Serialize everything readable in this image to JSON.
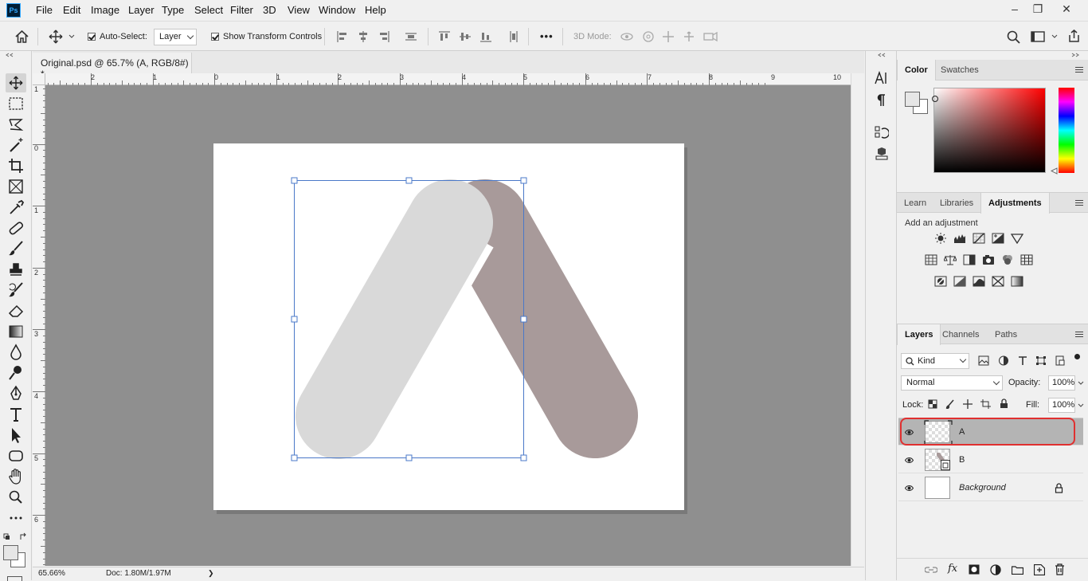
{
  "app": {
    "logo_text": "Ps",
    "menu": [
      "File",
      "Edit",
      "Image",
      "Layer",
      "Type",
      "Select",
      "Filter",
      "3D",
      "View",
      "Window",
      "Help"
    ],
    "window_controls": {
      "minimize": "‒",
      "restore": "❐",
      "close": "✕"
    }
  },
  "options_bar": {
    "auto_select_label": "Auto-Select:",
    "auto_select_checked": true,
    "auto_select_target": "Layer",
    "show_transform_label": "Show Transform Controls",
    "show_transform_checked": true,
    "more_label": "•••",
    "mode_3d_label": "3D Mode:"
  },
  "document": {
    "tab_title": "Original.psd @ 65.7% (A, RGB/8#) *",
    "ruler_h_labels": [
      "2",
      "1",
      "0",
      "1",
      "2",
      "3",
      "4",
      "5",
      "6",
      "7",
      "8",
      "9",
      "10"
    ],
    "ruler_v_labels": [
      "1",
      "0",
      "1",
      "2",
      "3",
      "4",
      "5",
      "6"
    ],
    "zoom": "65.66%",
    "doc_size": "Doc: 1.80M/1.97M",
    "status_arrow": "❯"
  },
  "panels": {
    "color_tabs": [
      "Color",
      "Swatches"
    ],
    "adjust_tabs": [
      "Learn",
      "Libraries",
      "Adjustments"
    ],
    "adjust_hint": "Add an adjustment",
    "layers_tabs": [
      "Layers",
      "Channels",
      "Paths"
    ],
    "filter_kind": "Kind",
    "blend_mode": "Normal",
    "opacity_label": "Opacity:",
    "opacity_value": "100%",
    "lock_label": "Lock:",
    "fill_label": "Fill:",
    "fill_value": "100%",
    "layers": [
      {
        "name": "A",
        "selected": true
      },
      {
        "name": "B",
        "selected": false
      },
      {
        "name": "Background",
        "selected": false
      }
    ]
  },
  "colors": {
    "shape_a": "#d9d9d9",
    "shape_b": "#a89a9a",
    "selection_outline": "#e03030",
    "transform_box": "#4a78c8"
  }
}
